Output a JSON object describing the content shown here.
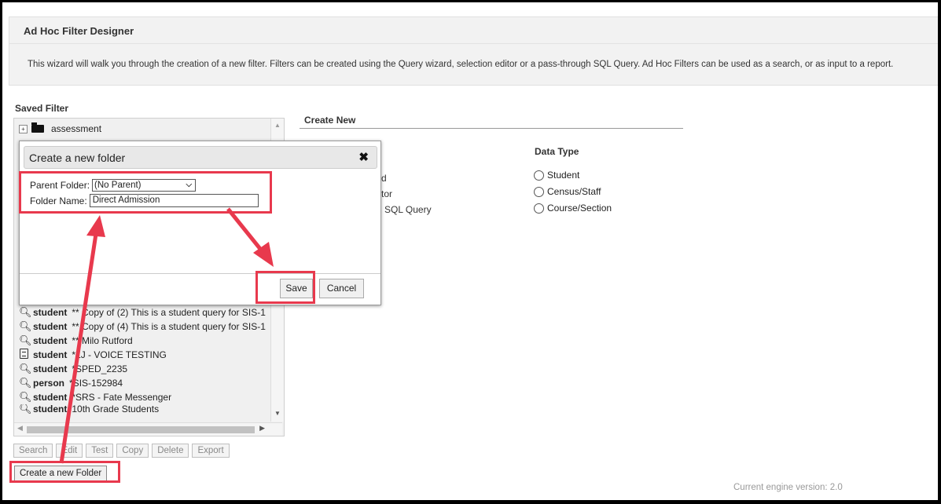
{
  "header": {
    "title": "Ad Hoc Filter Designer",
    "description": "This wizard will walk you through the creation of a new filter. Filters can be created using the Query wizard, selection editor or a pass-through SQL Query. Ad Hoc Filters can be used as a search, or as input to a report."
  },
  "saved_filter": {
    "label": "Saved Filter",
    "folder": {
      "expander": "+",
      "name": "assessment"
    },
    "items": [
      {
        "icon": "magnifier-icon",
        "type": "student",
        "name": "** Copy of (2) This is a student query for SIS-1"
      },
      {
        "icon": "magnifier-icon",
        "type": "student",
        "name": "** Copy of (4) This is a student query for SIS-1"
      },
      {
        "icon": "magnifier-icon",
        "type": "student",
        "name": "** Milo Rutford"
      },
      {
        "icon": "document-icon",
        "type": "student",
        "name": "*LJ - VOICE TESTING"
      },
      {
        "icon": "magnifier-icon",
        "type": "student",
        "name": "*SPED_2235"
      },
      {
        "icon": "magnifier-icon",
        "type": "person",
        "name": "*SIS-152984"
      },
      {
        "icon": "magnifier-icon",
        "type": "student",
        "name": "*SRS - Fate Messenger"
      },
      {
        "icon": "magnifier-icon",
        "type": "student",
        "name": "10th Grade Students"
      }
    ]
  },
  "actions": {
    "search": "Search",
    "edit": "Edit",
    "test": "Test",
    "copy": "Copy",
    "delete": "Delete",
    "export": "Export",
    "create_folder": "Create a new Folder"
  },
  "create_new": {
    "label": "Create New",
    "partial_options": [
      "d",
      "tor",
      "SQL Query"
    ],
    "data_type_label": "Data Type",
    "data_types": [
      "Student",
      "Census/Staff",
      "Course/Section"
    ]
  },
  "engine_version": "Current engine version: 2.0",
  "dialog": {
    "title": "Create a new folder",
    "close": "✖",
    "parent_label": "Parent Folder:",
    "parent_value": "(No Parent)",
    "name_label": "Folder Name:",
    "name_value": "Direct Admission",
    "save": "Save",
    "cancel": "Cancel"
  },
  "colors": {
    "highlight": "#e8394d",
    "panel": "#f0f0f0"
  }
}
